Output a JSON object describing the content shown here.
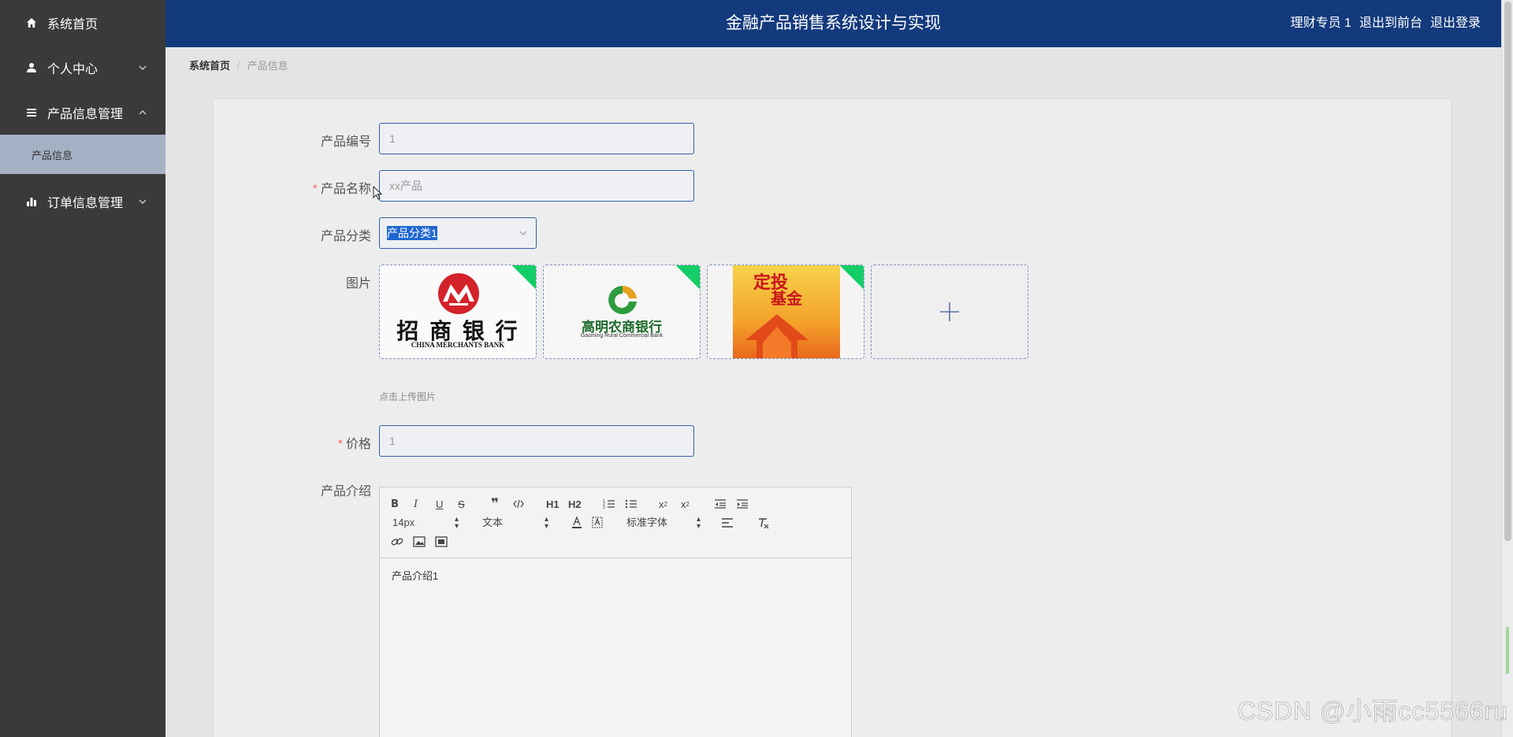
{
  "header": {
    "title": "金融产品销售系统设计与实现",
    "user": "理财专员 1",
    "front_link": "退出到前台",
    "logout_link": "退出登录"
  },
  "sidebar": {
    "items": [
      {
        "label": "系统首页",
        "icon": "home-icon"
      },
      {
        "label": "个人中心",
        "icon": "user-icon"
      },
      {
        "label": "产品信息管理",
        "icon": "list-icon"
      },
      {
        "label": "产品信息",
        "icon": ""
      },
      {
        "label": "订单信息管理",
        "icon": "bar-chart-icon"
      }
    ]
  },
  "breadcrumb": {
    "home": "系统首页",
    "separator": "/",
    "current": "产品信息"
  },
  "form": {
    "product_no_label": "产品编号",
    "product_no_value": "1",
    "product_name_label": "产品名称",
    "product_name_placeholder": "xx产品",
    "category_label": "产品分类",
    "category_value": "产品分类1",
    "image_label": "图片",
    "images": [
      {
        "caption_main": "招 商 银 行",
        "caption_sub": "CHINA MERCHANTS BANK"
      },
      {
        "caption_main": "高明农商银行",
        "caption_sub": "Gaoming Rural Commercial Bank"
      },
      {
        "caption_main": "定投",
        "caption_sub": "基金"
      }
    ],
    "upload_hint": "点击上传图片",
    "price_label": "价格",
    "price_value": "1",
    "intro_label": "产品介绍",
    "required_mark": "*"
  },
  "editor": {
    "size_picker": "14px",
    "header_picker": "文本",
    "font_picker": "标准字体",
    "content": "产品介绍1",
    "h1": "H1",
    "h2": "H2"
  },
  "watermark": "CSDN @小雨cc5566ru",
  "colors": {
    "header_bg": "#133a7c",
    "sidebar_bg": "#3a3a3a",
    "submenu_active_bg": "#a4b0c3",
    "required": "#f56c6c",
    "selected_corner": "#13ce66"
  }
}
